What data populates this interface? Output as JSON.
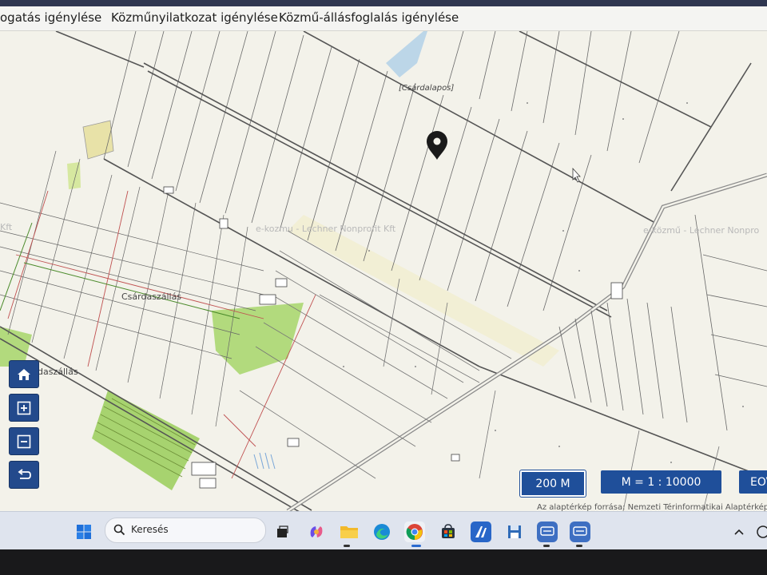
{
  "menu": {
    "items": [
      {
        "label": "ogatás igénylése"
      },
      {
        "label": "Közműnyilatkozat igénylése"
      },
      {
        "label": "Közmű-állásfoglalás igénylése"
      }
    ]
  },
  "map": {
    "labels": {
      "place_top": "[Csárdalapos]",
      "town": "Csárdaszállás",
      "town_lower": "daszállás"
    },
    "watermarks": {
      "center": "e-kozmu - Lechner Nonprofit Kft",
      "right": "e-közmű - Lechner Nonpro",
      "left": "Kft"
    },
    "controls": {
      "home_icon": "home-icon",
      "zoom_in_icon": "plus-square-icon",
      "zoom_out_icon": "minus-square-icon",
      "back_icon": "undo-arrow-icon"
    },
    "scale_bar": "200 M",
    "scale_ratio": "M = 1 : 10000",
    "projection": "EOV",
    "attribution": "Az alaptérkép forrása: Nemzeti Térinformatikai Alaptérkép, Opc",
    "marker_icon": "location-pin-icon",
    "accent_color": "#1f4f9a"
  },
  "taskbar": {
    "search_placeholder": "Keresés",
    "icons": [
      "windows-start-icon",
      "search-icon",
      "task-view-icon",
      "copilot-icon",
      "file-explorer-icon",
      "edge-icon",
      "chrome-icon",
      "store-icon",
      "app-icon",
      "save-disk-icon",
      "remote-app-icon",
      "remote-app-icon",
      "chevron-up-icon",
      "network-icon"
    ]
  }
}
